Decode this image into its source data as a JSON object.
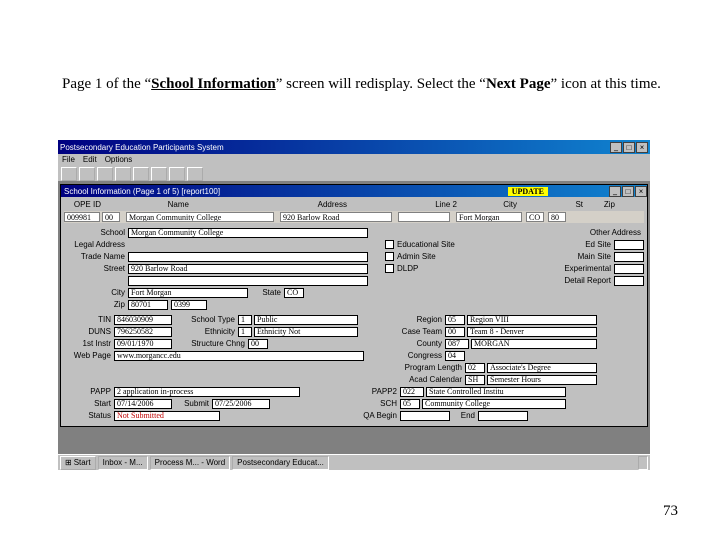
{
  "instruction": {
    "pre": "Page 1 of the “",
    "bold_underline": "School Information",
    "mid": "” screen will redisplay.  Select the “",
    "bold2": "Next Page",
    "post": "” icon at this time."
  },
  "outerTitle": "Postsecondary Education Participants System",
  "menu": {
    "file": "File",
    "edit": "Edit",
    "opts": "Options"
  },
  "innerTitle": "School Information (Page 1 of 5) [report100]",
  "flag": "UPDATE",
  "hdr": {
    "ope": "OPE ID",
    "name": "Name",
    "addr": "Address",
    "line2": "Line 2",
    "city": "City",
    "st": "St",
    "zip": "Zip"
  },
  "top": {
    "ope_v": "009981",
    "ope_sfx": "00",
    "name_v": "Morgan Community College",
    "addr_v": "920 Barlow Road",
    "city_v": "Fort Morgan",
    "st_v": "CO",
    "zip_v": "80"
  },
  "labels": {
    "school": "School",
    "legal": "Legal Address",
    "trade": "Trade Name",
    "street": "Street",
    "city": "City",
    "state": "State",
    "zip": "Zip",
    "other": "Other Address",
    "edu": "Educational Site",
    "edsite": "Ed Site",
    "admin": "Admin Site",
    "mainSite": "Main Site",
    "dldp": "DLDP",
    "experimental": "Experimental",
    "detail": "Detail Report",
    "tin": "TIN",
    "schoolType": "School Type",
    "duns": "DUNS",
    "ethnicity": "Ethnicity",
    "firstInstr": "1st Instr",
    "structChng": "Structure Chng",
    "webPage": "Web Page",
    "region": "Region",
    "caseTeam": "Case Team",
    "county": "County",
    "congress": "Congress",
    "progLen": "Program Length",
    "acadCal": "Acad Calendar",
    "papp": "PAPP",
    "papp2": "PAPP2",
    "start": "Start",
    "submit": "Submit",
    "status": "Status",
    "qaBegin": "QA Begin",
    "sch": "SCH",
    "end": "End"
  },
  "values": {
    "school": "Morgan Community College",
    "street": "920 Barlow Road",
    "city": "Fort Morgan",
    "state": "CO",
    "zip1": "80701",
    "zip2": "0399",
    "tin": "846030909",
    "schoolTypeCode": "1",
    "schoolTypeText": "Public",
    "duns": "796250582",
    "ethnicityCode": "1",
    "ethnicityText": "Ethnicity Not",
    "firstInstr": "09/01/1970",
    "structChng": "00",
    "webPage": "www.morgancc.edu",
    "regionCode": "05",
    "regionText": "Region VIII",
    "caseTeamCode": "00",
    "caseTeamText": "Team 8 - Denver",
    "countyCode": "087",
    "countyText": "MORGAN",
    "congress": "04",
    "progLenCode": "02",
    "progLenText": "Associate's Degree",
    "acadCalCode": "SH",
    "acadCalText": "Semester Hours",
    "papp": "2 application in-process",
    "papp2Code": "022",
    "papp2Text": "State Controlled Institu",
    "startDate": "07/14/2006",
    "submitDate": "07/25/2006",
    "schCode": "05",
    "schText": "Community College",
    "status": "Not Submitted"
  },
  "taskbar": {
    "start": "Start",
    "btn1": "Inbox - M...",
    "btn2": "Process M... - Word",
    "btn3": "Postsecondary Educat..."
  },
  "pageNumber": "73"
}
